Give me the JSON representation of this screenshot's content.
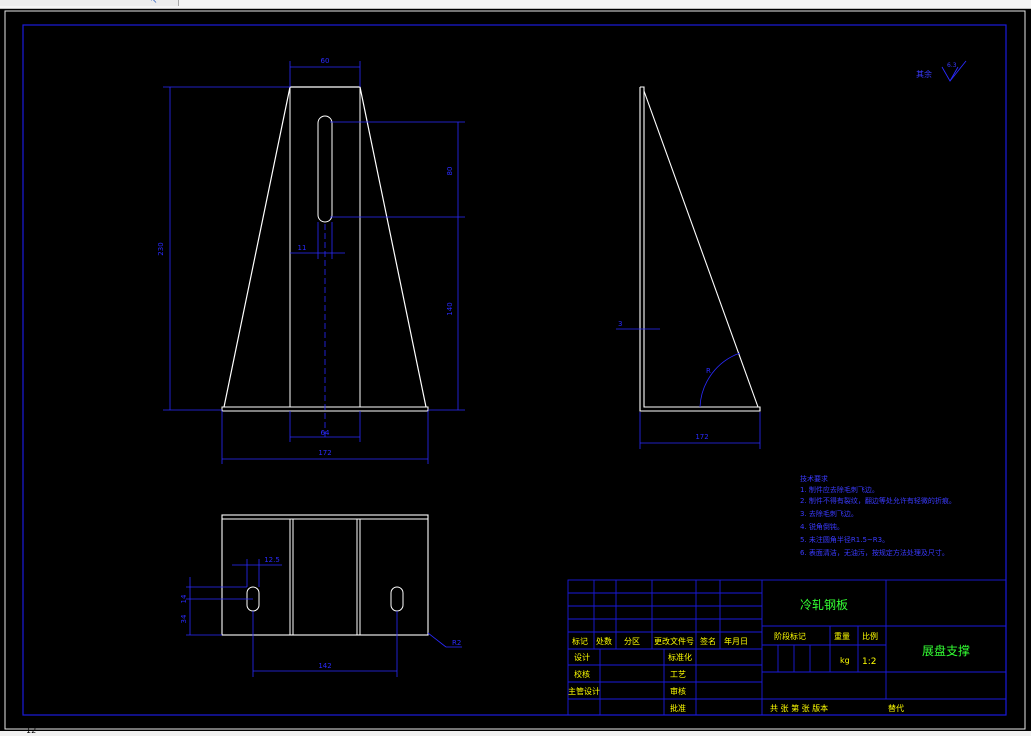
{
  "toolbar": {
    "icon": "cursor-icon"
  },
  "drawing": {
    "colors": {
      "background": "#000000",
      "frame": "#1a1adc",
      "part": "#ffffff",
      "dimension": "#2a2aff",
      "text_yellow": "#ffff00",
      "text_green": "#33ff33",
      "text_blue": "#3a3aff"
    },
    "front_view": {
      "dim_top": "60",
      "dim_overall_height": "230",
      "dim_slot_length": "80",
      "dim_lower": "140",
      "dim_slot_width": "11",
      "dim_base_inner": "64",
      "dim_base_width": "172"
    },
    "side_view": {
      "dim_thickness": "3",
      "dim_radius": "R",
      "dim_depth": "172"
    },
    "top_view": {
      "dim_slot": "12.5",
      "dim_a": "14",
      "dim_b": "34",
      "dim_pitch": "142",
      "dim_corner": "R2"
    },
    "roughness": {
      "label": "其余",
      "value": "6.3"
    },
    "tech_notes": {
      "title": "技术要求",
      "lines": [
        "1. 制件应去除毛刺飞边。",
        "2. 制件不得有裂纹，翻边等处允许有轻微的折痕。",
        "3. 去除毛刺飞边。",
        "4. 锐角倒钝。",
        "5. 未注圆角半径R1.5~R3。",
        "6. 表面清洁，无油污，按规定方法处理及尺寸。"
      ]
    },
    "title_block": {
      "material": "冷轧钢板",
      "part_name": "展盘支撑",
      "scale": "1:2",
      "weight_unit": "kg",
      "hdr_stage": "阶段标记",
      "hdr_weight": "重量",
      "hdr_scale": "比例",
      "hdr_mark": "标记",
      "hdr_count": "处数",
      "hdr_zone": "分区",
      "hdr_docno": "更改文件号",
      "hdr_sign": "签名",
      "hdr_date": "年月日",
      "row_design": "设计",
      "row_standard": "标准化",
      "row_check": "校核",
      "row_craft": "工艺",
      "row_chief": "主管设计",
      "row_review": "审核",
      "row_approve": "批准",
      "sheets": "共  张  第  张  版本",
      "replace": "替代"
    }
  },
  "status": {
    "text": "12"
  }
}
